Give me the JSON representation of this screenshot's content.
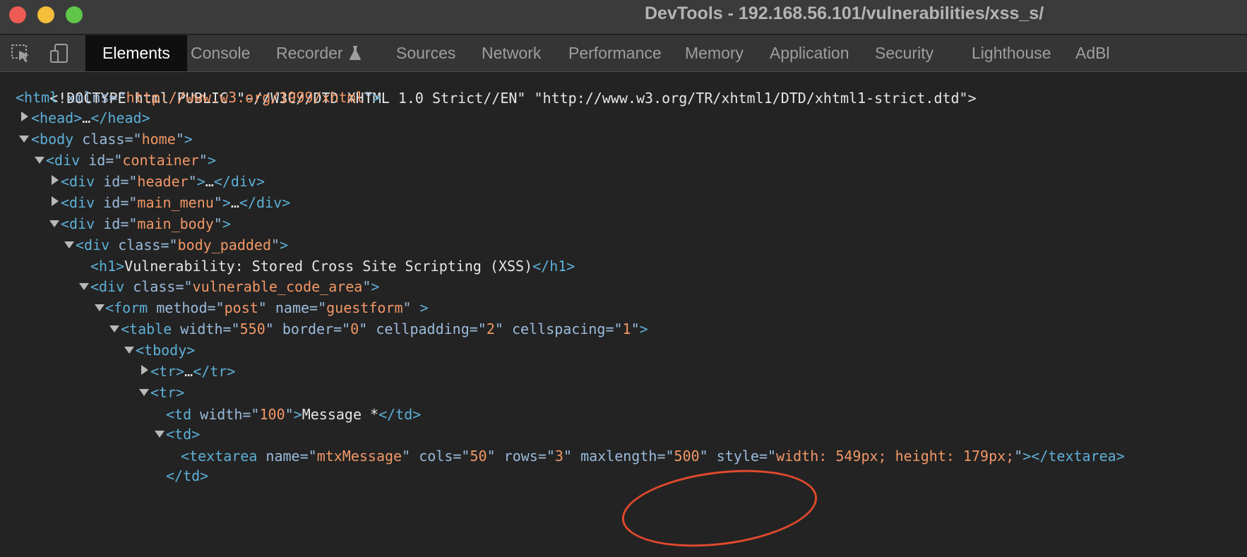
{
  "window": {
    "title": "DevTools - 192.168.56.101/vulnerabilities/xss_s/"
  },
  "toolbar": {
    "icons": [
      "inspect-element-icon",
      "device-toolbar-icon"
    ],
    "tabs": [
      {
        "label": "Elements",
        "active": true
      },
      {
        "label": "Console"
      },
      {
        "label": "Recorder",
        "icon": "flask-icon"
      },
      {
        "label": "Sources"
      },
      {
        "label": "Network"
      },
      {
        "label": "Performance"
      },
      {
        "label": "Memory"
      },
      {
        "label": "Application"
      },
      {
        "label": "Security"
      },
      {
        "label": "Lighthouse"
      },
      {
        "label": "AdBl"
      }
    ]
  },
  "dom": {
    "doctype": "<!DOCTYPE html PUBLIC \"-//W3C//DTD XHTML 1.0 Strict//EN\" \"http://www.w3.org/TR/xhtml1/DTD/xhtml1-strict.dtd\">",
    "html_tag": "html",
    "html_attr": "xmlns",
    "html_xmlns": "http://www.w3.org/1999/xhtml",
    "head": "head",
    "body_class": "home",
    "container_id": "container",
    "header_id": "header",
    "main_menu_id": "main_menu",
    "main_body_id": "main_body",
    "body_padded_class": "body_padded",
    "h1_text": "Vulnerability: Stored Cross Site Scripting (XSS)",
    "code_area_class": "vulnerable_code_area",
    "form_method": "post",
    "form_name": "guestform",
    "form_extra": " ",
    "table_width": "550",
    "table_border": "0",
    "table_cellpadding": "2",
    "table_cellspacing": "1",
    "td_width": "100",
    "td_text": "Message *",
    "textarea_name": "mtxMessage",
    "textarea_cols": "50",
    "textarea_rows": "3",
    "textarea_maxlength": "500",
    "textarea_style": "width: 549px; height: 179px;",
    "ellipsis": "…"
  },
  "colors": {
    "tag": "#5db0d7",
    "attr_name": "#9bbbdc",
    "attr_value": "#f29766",
    "annotation": "#e0492e"
  }
}
